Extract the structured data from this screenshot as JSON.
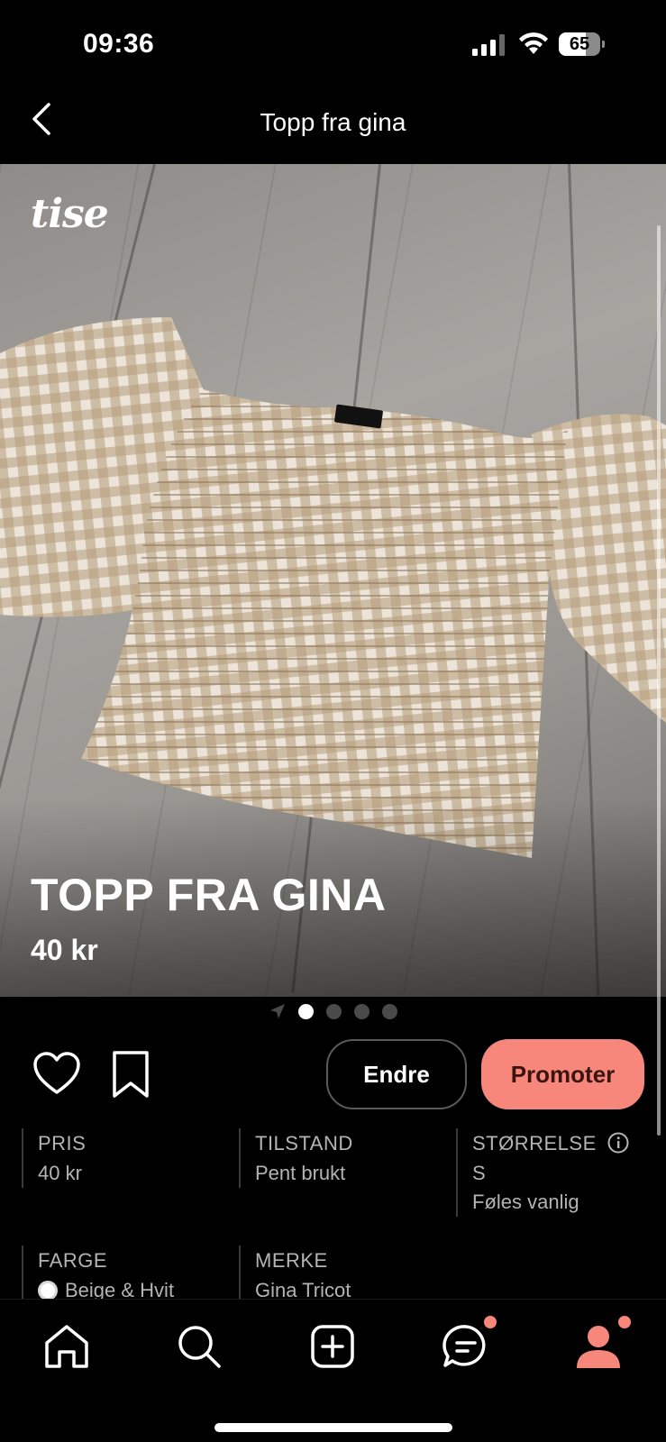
{
  "status_bar": {
    "time": "09:36",
    "battery_level": "65",
    "battery_fraction": 0.65
  },
  "header": {
    "title": "Topp fra gina",
    "back_icon": "chevron-left-icon"
  },
  "product": {
    "logo_text": "tise",
    "title": "TOPP FRA GINA",
    "price": "40 kr",
    "image_count": 4,
    "active_image_index": 0
  },
  "actions": {
    "edit_label": "Endre",
    "promote_label": "Promoter",
    "promote_color": "#f7877a"
  },
  "details": {
    "price": {
      "label": "PRIS",
      "value": "40 kr"
    },
    "condition": {
      "label": "TILSTAND",
      "value": "Pent brukt"
    },
    "size": {
      "label": "STØRRELSE",
      "value": "S",
      "fit": "Føles vanlig"
    },
    "color": {
      "label": "FARGE",
      "value": "Beige & Hvit"
    },
    "brand": {
      "label": "MERKE",
      "value": "Gina Tricot"
    }
  },
  "bottom_nav": {
    "items": [
      "home-icon",
      "search-icon",
      "add-icon",
      "messages-icon",
      "profile-icon"
    ],
    "badge_color": "#f7877a"
  }
}
